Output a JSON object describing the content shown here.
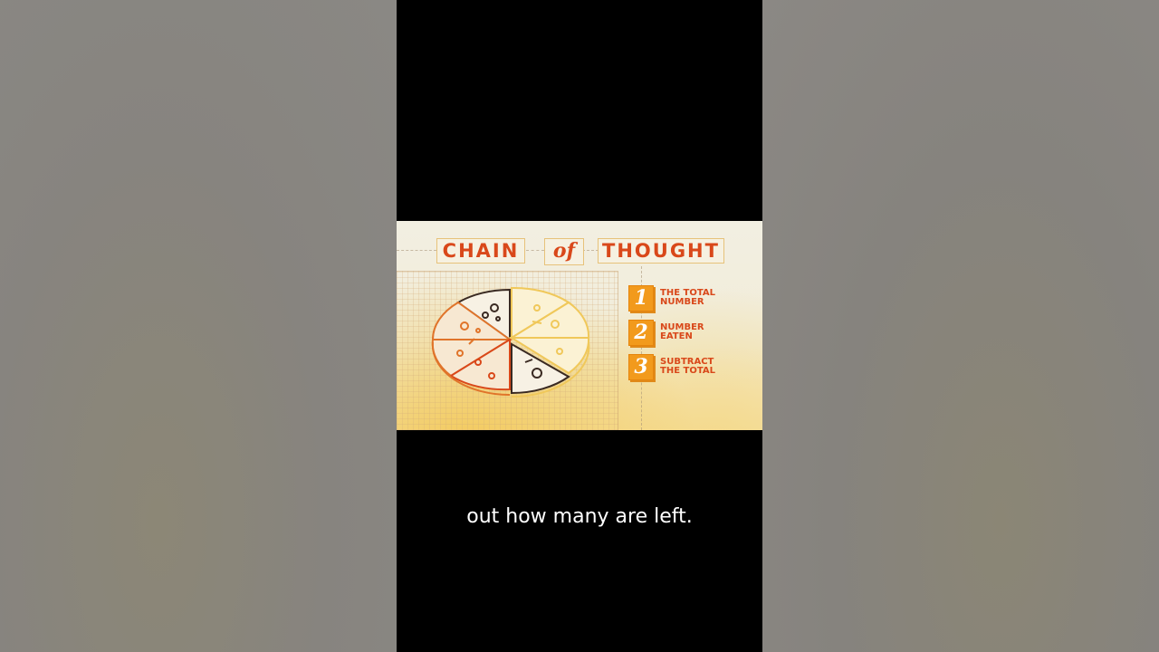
{
  "video": {
    "title_left": "CHAIN",
    "title_mid": "of",
    "title_right": "THOUGHT",
    "steps": [
      {
        "num": "1",
        "line1": "THE TOTAL",
        "line2": "NUMBER"
      },
      {
        "num": "2",
        "line1": "NUMBER",
        "line2": "EATEN"
      },
      {
        "num": "3",
        "line1": "SUBTRACT",
        "line2": "THE TOTAL"
      }
    ],
    "caption": "out how many are left."
  },
  "colors": {
    "accent": "#d9481a",
    "step_box": "#f29a1c",
    "background_black": "#000000"
  }
}
